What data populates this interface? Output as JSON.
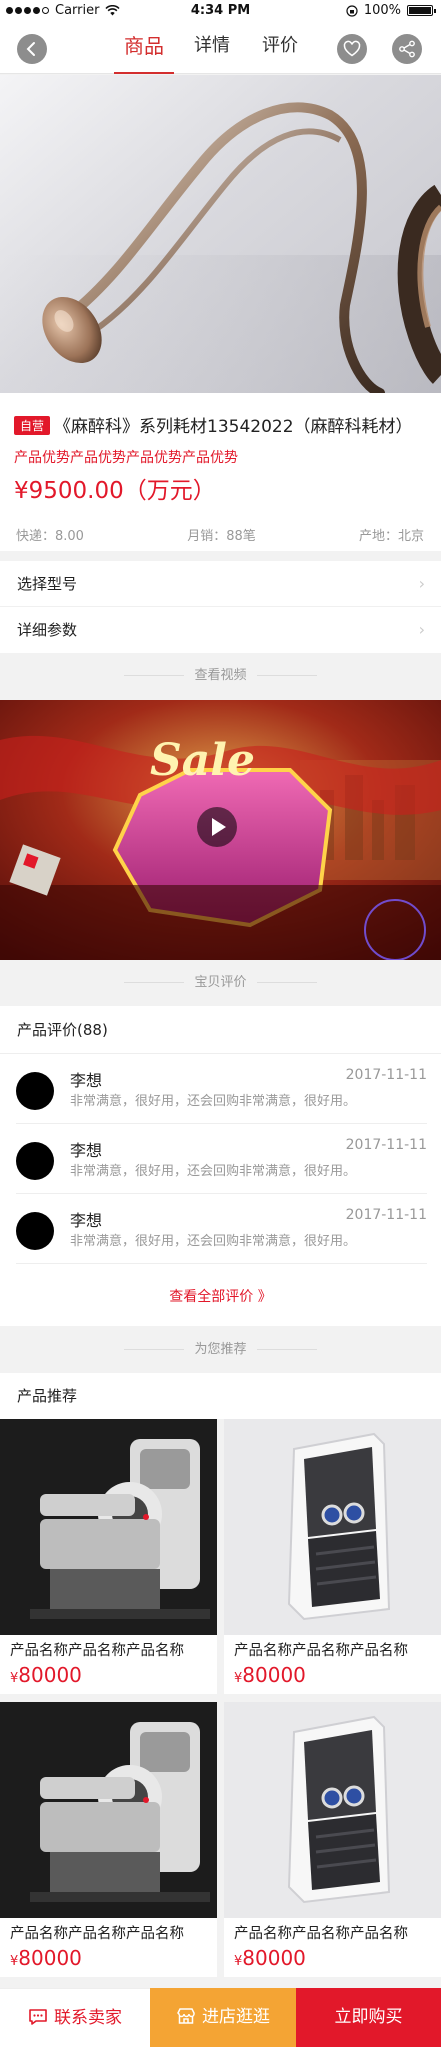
{
  "status_bar": {
    "carrier": "Carrier",
    "time": "4:34 PM",
    "battery": "100%"
  },
  "nav": {
    "back_icon": "chevron-left-icon",
    "tabs": [
      {
        "label": "商品",
        "active": true
      },
      {
        "label": "详情",
        "active": false
      },
      {
        "label": "评价",
        "active": false
      }
    ],
    "favorite_icon": "heart-icon",
    "share_icon": "share-icon"
  },
  "product": {
    "tag": "自营",
    "title": "《麻醉科》系列耗材13542022（麻醉科耗材）",
    "advantage": "产品优势产品优势产品优势产品优势",
    "price": "¥9500.00（万元）",
    "shipping": "快递：8.00",
    "monthly_sales": "月销：88笔",
    "origin": "产地：北京"
  },
  "options": [
    {
      "label": "选择型号"
    },
    {
      "label": "详细参数"
    }
  ],
  "video_section": {
    "title": "查看视频"
  },
  "review_section": {
    "title": "宝贝评价"
  },
  "reviews": {
    "header": "产品评价(88)",
    "items": [
      {
        "name": "李想",
        "date": "2017-11-11",
        "text": "非常满意，很好用，还会回购非常满意，很好用。"
      },
      {
        "name": "李想",
        "date": "2017-11-11",
        "text": "非常满意，很好用，还会回购非常满意，很好用。"
      },
      {
        "name": "李想",
        "date": "2017-11-11",
        "text": "非常满意，很好用，还会回购非常满意，很好用。"
      }
    ],
    "see_all": "查看全部评价 》"
  },
  "recommend_section": {
    "title": "为您推荐"
  },
  "recommend": {
    "header": "产品推荐",
    "items": [
      {
        "name": "产品名称产品名称产品名称",
        "currency": "¥",
        "price": "80000"
      },
      {
        "name": "产品名称产品名称产品名称",
        "currency": "¥",
        "price": "80000"
      },
      {
        "name": "产品名称产品名称产品名称",
        "currency": "¥",
        "price": "80000"
      },
      {
        "name": "产品名称产品名称产品名称",
        "currency": "¥",
        "price": "80000"
      }
    ]
  },
  "bottom_bar": {
    "contact": "联系卖家",
    "shop": "进店逛逛",
    "buy": "立即购买"
  },
  "colors": {
    "accent": "#e2182a",
    "shop_orange": "#f4a434",
    "nav_active": "#d32e2e"
  }
}
